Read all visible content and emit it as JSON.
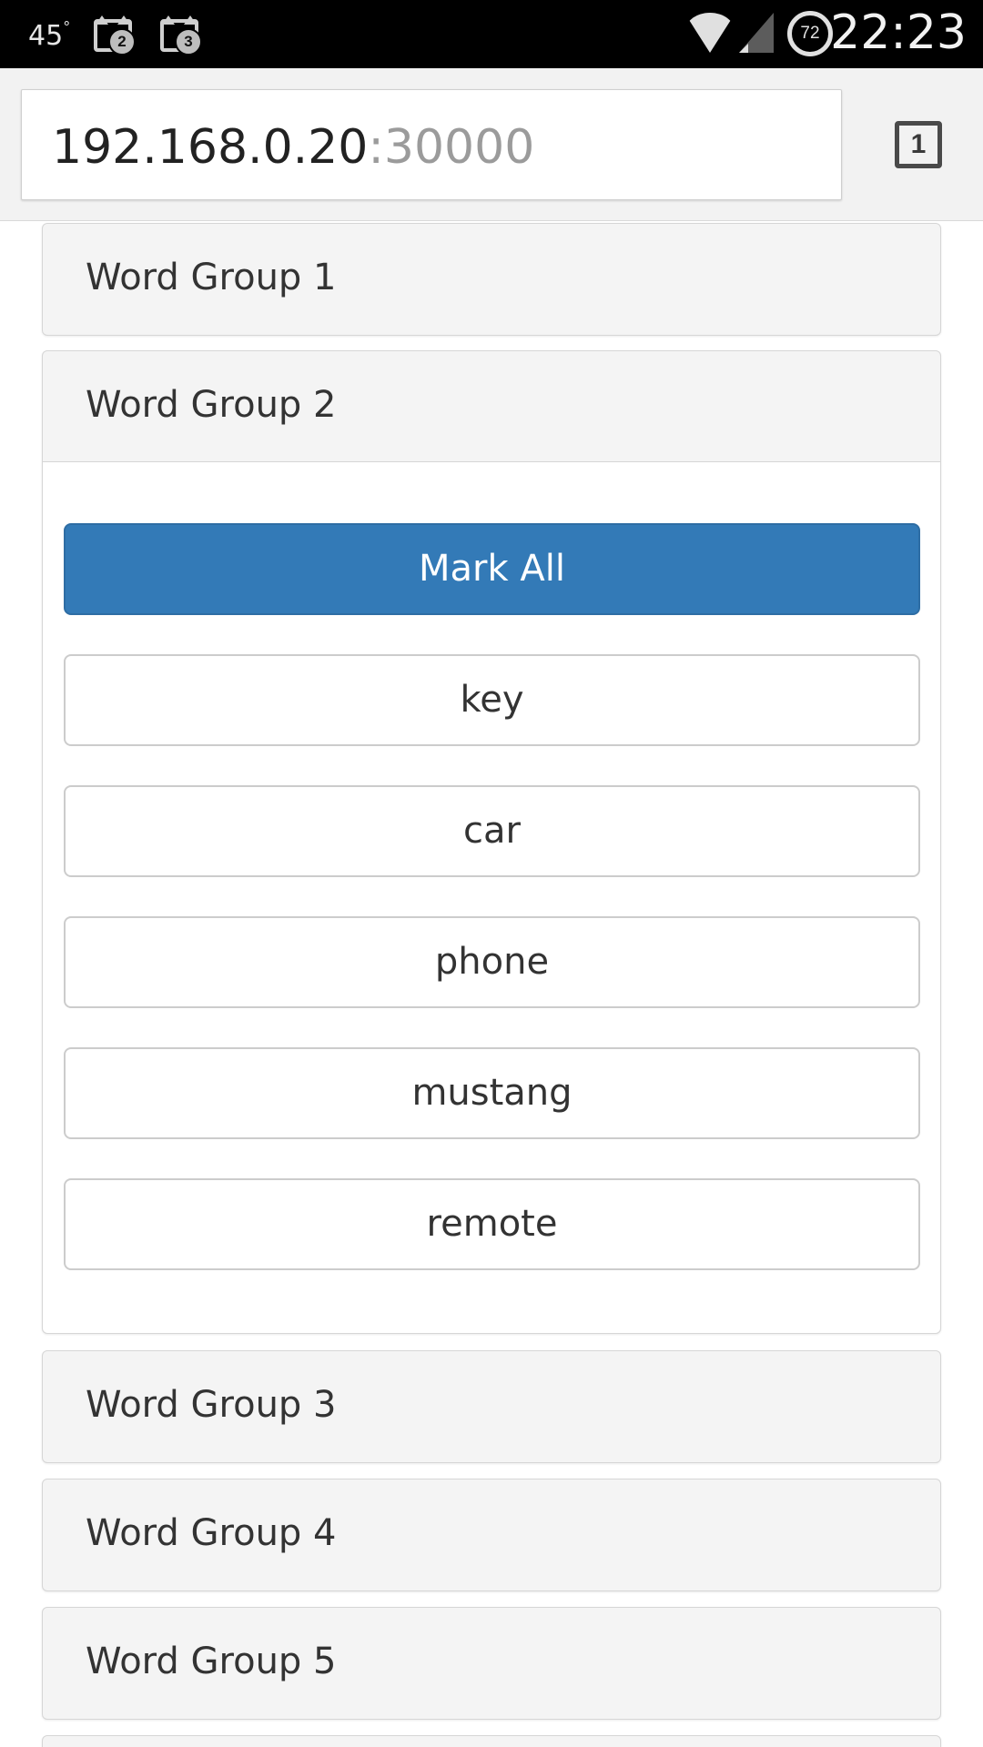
{
  "status_bar": {
    "temperature": "45",
    "temperature_unit": "°",
    "notifications": [
      {
        "icon": "cat-notification-icon",
        "count": "2"
      },
      {
        "icon": "cat-notification-icon",
        "count": "3"
      }
    ],
    "wifi_icon": "wifi-icon",
    "signal_icon": "cellular-signal-icon",
    "battery_level": "72",
    "time": "22:23"
  },
  "browser": {
    "url_host": "192.168.0.20",
    "url_port": ":30000",
    "tab_count": "1"
  },
  "accordion": {
    "groups": [
      {
        "title": "Word Group 1",
        "expanded": false
      },
      {
        "title": "Word Group 2",
        "expanded": true
      },
      {
        "title": "Word Group 3",
        "expanded": false
      },
      {
        "title": "Word Group 4",
        "expanded": false
      },
      {
        "title": "Word Group 5",
        "expanded": false
      }
    ],
    "open_group": {
      "mark_all_label": "Mark All",
      "words": [
        "key",
        "car",
        "phone",
        "mustang",
        "remote"
      ]
    }
  },
  "colors": {
    "primary": "#337ab7",
    "panel_bg": "#f4f4f4",
    "status_bar": "#000000"
  }
}
